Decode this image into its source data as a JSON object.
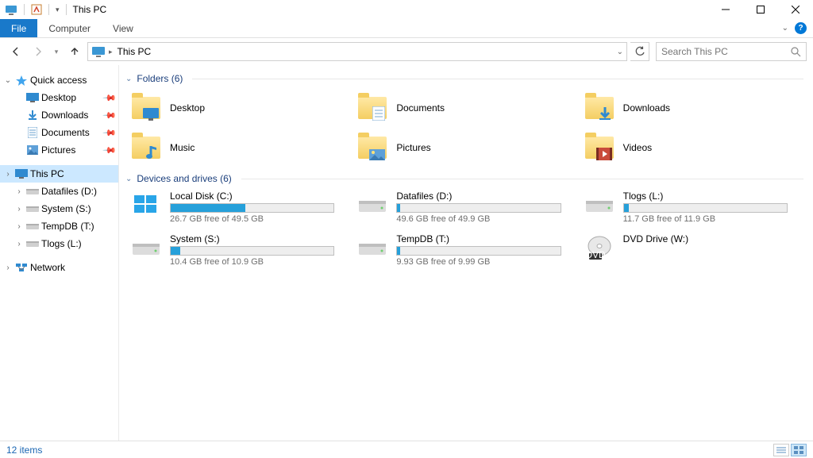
{
  "window": {
    "title": "This PC"
  },
  "ribbon": {
    "file": "File",
    "tabs": [
      "Computer",
      "View"
    ]
  },
  "address": {
    "crumb": "This PC"
  },
  "search": {
    "placeholder": "Search This PC"
  },
  "sidebar": {
    "quick_access": "Quick access",
    "qa_items": [
      {
        "label": "Desktop"
      },
      {
        "label": "Downloads"
      },
      {
        "label": "Documents"
      },
      {
        "label": "Pictures"
      }
    ],
    "this_pc": "This PC",
    "pc_items": [
      {
        "label": "Datafiles (D:)"
      },
      {
        "label": "System (S:)"
      },
      {
        "label": "TempDB (T:)"
      },
      {
        "label": "Tlogs (L:)"
      }
    ],
    "network": "Network"
  },
  "groups": {
    "folders_title": "Folders (6)",
    "drives_title": "Devices and drives (6)"
  },
  "folders": [
    {
      "label": "Desktop"
    },
    {
      "label": "Documents"
    },
    {
      "label": "Downloads"
    },
    {
      "label": "Music"
    },
    {
      "label": "Pictures"
    },
    {
      "label": "Videos"
    }
  ],
  "drives": [
    {
      "label": "Local Disk (C:)",
      "sub": "26.7 GB free of 49.5 GB",
      "used_pct": 46,
      "os": true
    },
    {
      "label": "Datafiles (D:)",
      "sub": "49.6 GB free of 49.9 GB",
      "used_pct": 2
    },
    {
      "label": "Tlogs (L:)",
      "sub": "11.7 GB free of 11.9 GB",
      "used_pct": 3
    },
    {
      "label": "System (S:)",
      "sub": "10.4 GB free of 10.9 GB",
      "used_pct": 6
    },
    {
      "label": "TempDB (T:)",
      "sub": "9.93 GB free of 9.99 GB",
      "used_pct": 2
    },
    {
      "label": "DVD Drive (W:)",
      "sub": "",
      "dvd": true
    }
  ],
  "status": {
    "items": "12 items"
  }
}
